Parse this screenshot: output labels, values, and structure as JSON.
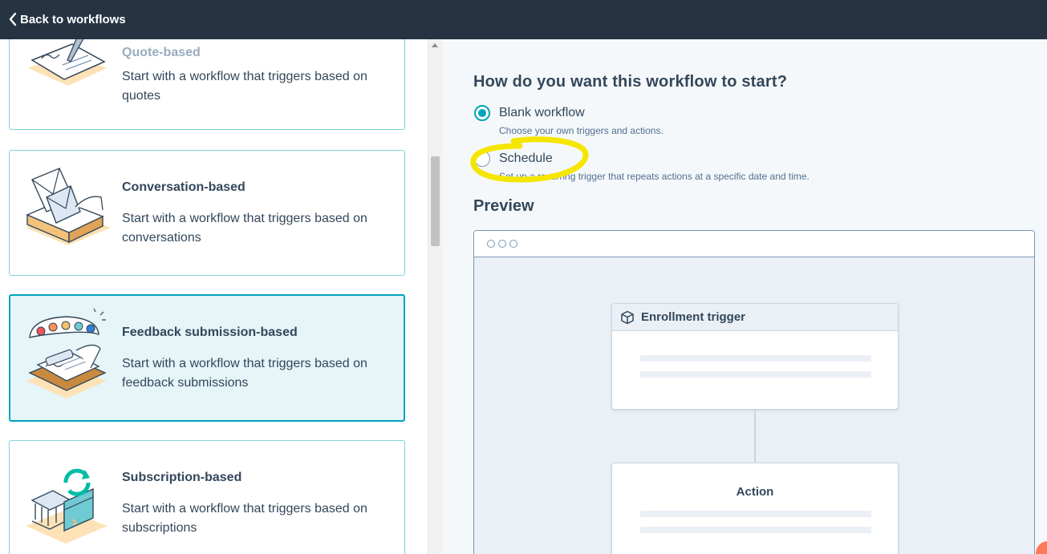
{
  "topbar": {
    "back_label": "Back to workflows"
  },
  "cards": [
    {
      "title": "Quote-based",
      "desc": "Start with a workflow that triggers based on quotes",
      "selected": false,
      "icon": "quote-contract-icon"
    },
    {
      "title": "Conversation-based",
      "desc": "Start with a workflow that triggers based on conversations",
      "selected": false,
      "icon": "envelope-inbox-icon"
    },
    {
      "title": "Feedback submission-based",
      "desc": "Start with a workflow that triggers based on feedback submissions",
      "selected": true,
      "icon": "feedback-rating-icon"
    },
    {
      "title": "Subscription-based",
      "desc": "Start with a workflow that triggers based on subscriptions",
      "selected": false,
      "icon": "bank-card-cycle-icon"
    }
  ],
  "start": {
    "question": "How do you want this workflow to start?",
    "options": [
      {
        "label": "Blank workflow",
        "help": "Choose your own triggers and actions.",
        "checked": true
      },
      {
        "label": "Schedule",
        "help": "Set up a recurring trigger that repeats actions at a specific date and time.",
        "checked": false
      }
    ]
  },
  "preview": {
    "title": "Preview",
    "trigger_label": "Enrollment trigger",
    "action_label": "Action"
  },
  "colors": {
    "topbar": "#253342",
    "accent": "#00a4bd",
    "highlight": "#f5e600",
    "text": "#33475b"
  }
}
